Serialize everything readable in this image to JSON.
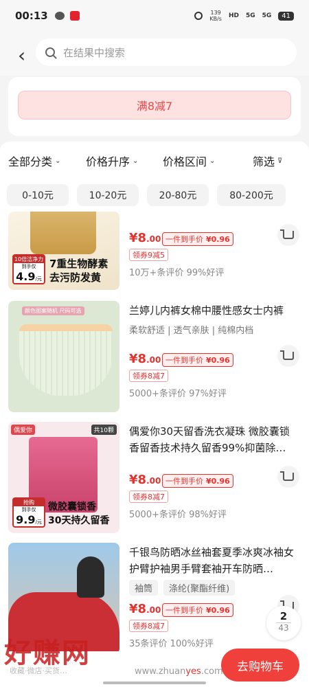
{
  "status": {
    "time": "00:13",
    "net_speed_top": "139",
    "net_speed_bottom": "KB/s",
    "hd": "HD",
    "sig1": "5G",
    "sig2": "5G",
    "battery": "41"
  },
  "search": {
    "placeholder": "在结果中搜索"
  },
  "promo": {
    "label": "满8减7"
  },
  "sort": {
    "category": "全部分类",
    "price_sort": "价格升序",
    "price_range": "价格区间",
    "filter": "筛选"
  },
  "chips": [
    "0-10元",
    "10-20元",
    "20-80元",
    "80-200元"
  ],
  "products": [
    {
      "title": "",
      "price": "8",
      "price_dec": ".00",
      "hand_label": "一件到手价",
      "hand_price": "¥0.96",
      "coupon": "领券9减5",
      "reviews": "10万+条评价  99%好评",
      "art": {
        "badge_top": "10倍洁净力",
        "badge_small": "到手仅",
        "badge_big": "4.9",
        "badge_unit": "/元",
        "caption1": "7重生物酵素",
        "caption2": "去污防发黄"
      }
    },
    {
      "title": "兰婷儿内裤女棉中腰性感女士内裤",
      "tags": "柔软舒适 | 透气亲肤 | 纯棉内档",
      "price": "8",
      "price_dec": ".00",
      "hand_label": "一件到手价",
      "hand_price": "¥0.96",
      "coupon": "领券8减7",
      "reviews": "5000+条评价  97%好评",
      "art": {
        "banner": "颜色图案随机 尺码可选"
      }
    },
    {
      "title": "偶爱你30天留香洗衣凝珠 微胶囊锁香留香技术持久留香99%抑菌除…",
      "price": "8",
      "price_dec": ".00",
      "hand_label": "一件到手价",
      "hand_price": "¥0.96",
      "coupon": "领券8减7",
      "reviews": "5000+条评价  98%好评",
      "art": {
        "brand": "偶爱你",
        "count": "共10颗",
        "badge_small": "到手仅",
        "badge_top": "抢购",
        "badge_big": "9.9",
        "badge_unit": "/元",
        "caption1": "微胶囊锁香",
        "caption2": "30天持久留香"
      }
    },
    {
      "title": "千银鸟防晒冰丝袖套夏季冰爽冰袖女护臂护袖男手臂套袖开车防晒…",
      "tag1": "袖筒",
      "tag2": "涤纶(聚酯纤维)",
      "price": "8",
      "price_dec": ".00",
      "hand_label": "一件到手价",
      "hand_price": "¥0.96",
      "coupon": "领券8减7",
      "reviews": "35条评价  100%好评"
    }
  ],
  "pager": {
    "current": "2",
    "total": "43"
  },
  "bottom": {
    "watermark": "好赚网",
    "url_pre": "www.zhuan",
    "url_yes": "yes",
    "url_post": ".com",
    "sub": "收藏·微店·买货…",
    "go_cart": "去购物车"
  }
}
